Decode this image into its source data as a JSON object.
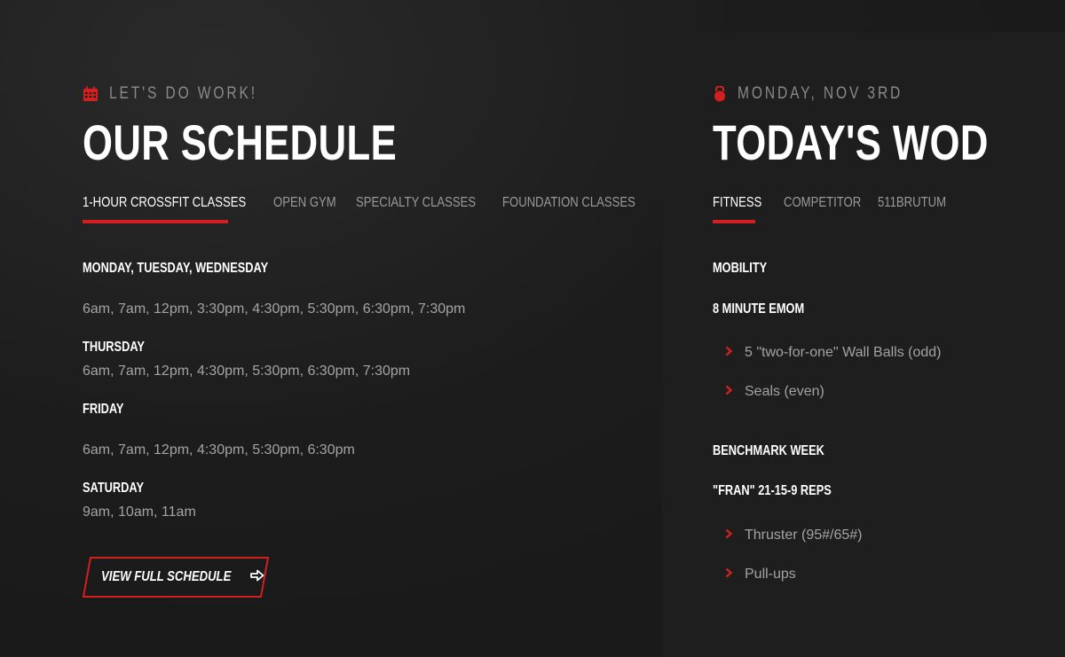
{
  "schedule": {
    "eyebrow": "LET'S DO WORK!",
    "title": "OUR SCHEDULE",
    "tabs": [
      {
        "label": "1-HOUR CROSSFIT CLASSES",
        "active": true
      },
      {
        "label": "OPEN GYM",
        "active": false
      },
      {
        "label": "SPECIALTY CLASSES",
        "active": false
      },
      {
        "label": "FOUNDATION CLASSES",
        "active": false
      }
    ],
    "days": [
      {
        "label": "MONDAY, TUESDAY, WEDNESDAY",
        "times": "6am, 7am, 12pm, 3:30pm, 4:30pm, 5:30pm, 6:30pm, 7:30pm"
      },
      {
        "label": "THURSDAY",
        "times": "6am, 7am, 12pm, 4:30pm, 5:30pm, 6:30pm, 7:30pm"
      },
      {
        "label": "FRIDAY",
        "times": "6am, 7am, 12pm, 4:30pm, 5:30pm, 6:30pm"
      },
      {
        "label": "SATURDAY",
        "times": "9am, 10am, 11am"
      }
    ],
    "button_label": "VIEW FULL SCHEDULE"
  },
  "wod": {
    "eyebrow": "MONDAY, NOV 3RD",
    "title": "TODAY'S WOD",
    "tabs": [
      {
        "label": "FITNESS",
        "active": true
      },
      {
        "label": "COMPETITOR",
        "active": false
      },
      {
        "label": "511BRUTUM",
        "active": false
      }
    ],
    "sections": [
      {
        "heading": "MOBILITY"
      },
      {
        "heading": "8 MINUTE EMOM",
        "items": [
          "5 \"two-for-one\" Wall Balls (odd)",
          "Seals (even)"
        ]
      },
      {
        "heading": "BENCHMARK WEEK"
      },
      {
        "heading": "\"FRAN\" 21-15-9 REPS",
        "items": [
          "Thruster (95#/65#)",
          "Pull-ups"
        ]
      }
    ]
  },
  "colors": {
    "accent": "#d41f1f",
    "background": "#1b1b1b",
    "panel": "#1e1e1e",
    "muted": "#a3a3a3"
  },
  "icons": {
    "schedule": "calendar-icon",
    "wod": "kettlebell-icon",
    "button": "arrow-right-icon",
    "bullet": "chevron-right-icon"
  }
}
